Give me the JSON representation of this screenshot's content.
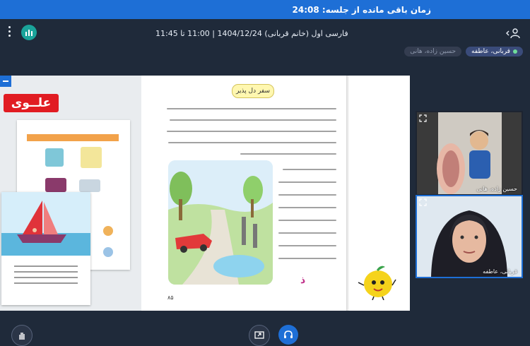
{
  "session": {
    "time_remaining": "زمان باقی مانده از جلسه: 24:08"
  },
  "header": {
    "title": "فارسی اول (خانم قربانی) 1404/12/24 | 11:00 تا 11:45"
  },
  "participants": {
    "chips": [
      {
        "label": "قربانی، عاطفه",
        "active": true
      },
      {
        "label": "حسین زاده، هانی",
        "active": false
      }
    ]
  },
  "book": {
    "publisher_logo": "علــوی",
    "lesson_title": "سفر دل پذیر",
    "page_number": "۸۵",
    "letter": "ذ"
  },
  "cameras": [
    {
      "name": "حسین زاده، هانی"
    },
    {
      "name": "قربانی، عاطفه"
    }
  ],
  "icons": {
    "menu": "more-vertical-icon",
    "stats": "bar-chart-icon",
    "user": "user-icon",
    "hand": "raise-hand-icon",
    "share": "screen-share-icon",
    "headset": "headset-icon"
  },
  "colors": {
    "top_banner": "#1e6fd6",
    "background": "#1f2a3a",
    "accent": "#1aa39a",
    "publisher_red": "#e11c22"
  }
}
